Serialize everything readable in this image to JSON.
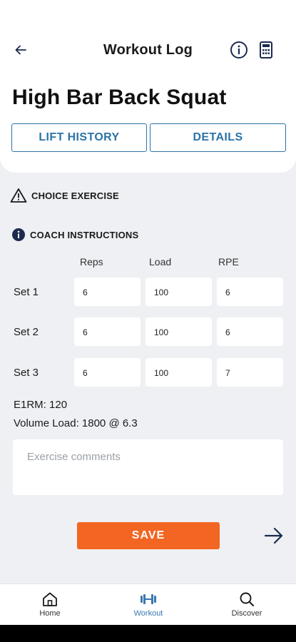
{
  "header": {
    "title": "Workout Log"
  },
  "exercise": {
    "name": "High Bar Back Squat"
  },
  "tabs": {
    "history": "LIFT HISTORY",
    "details": "DETAILS"
  },
  "notices": {
    "choice": "CHOICE EXERCISE",
    "coach": "COACH INSTRUCTIONS"
  },
  "columns": {
    "reps": "Reps",
    "load": "Load",
    "rpe": "RPE"
  },
  "sets": [
    {
      "label": "Set 1",
      "reps": "6",
      "load": "100",
      "rpe": "6"
    },
    {
      "label": "Set 2",
      "reps": "6",
      "load": "100",
      "rpe": "6"
    },
    {
      "label": "Set 3",
      "reps": "6",
      "load": "100",
      "rpe": "7"
    }
  ],
  "stats": {
    "e1rm": "E1RM: 120",
    "volume": "Volume Load: 1800 @ 6.3"
  },
  "comments": {
    "placeholder": "Exercise comments"
  },
  "actions": {
    "save": "SAVE"
  },
  "nav": {
    "home": "Home",
    "workout": "Workout",
    "discover": "Discover"
  },
  "colors": {
    "accent": "#f26522",
    "primary": "#2b73a8",
    "nav_active": "#3a78b0",
    "icon_dark": "#1b2a4e"
  },
  "icons": [
    "back-arrow-icon",
    "info-icon",
    "calculator-icon",
    "warning-icon",
    "info-filled-icon",
    "next-arrow-icon",
    "home-icon",
    "dumbbell-icon",
    "search-icon"
  ]
}
